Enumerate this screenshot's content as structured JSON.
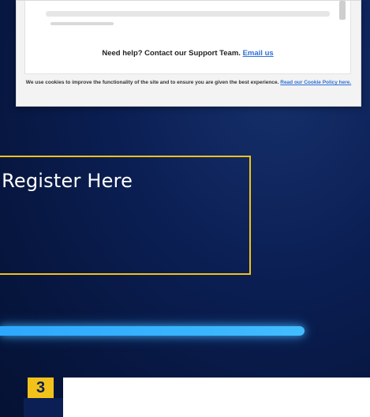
{
  "embed": {
    "help_text": "Need help? Contact our Support Team.",
    "help_link": "Email us",
    "cookie_text": "We use cookies to improve the functionality of the site and to ensure you are given the best experience.",
    "cookie_link": "Read our Cookie Policy here."
  },
  "register": {
    "text": ": Register Here"
  },
  "step": {
    "number": "3"
  },
  "colors": {
    "accent_yellow": "#f2c21b",
    "bar_blue": "#38b4ff",
    "background_navy": "#0b1f54",
    "link_blue": "#2f6fd6"
  }
}
